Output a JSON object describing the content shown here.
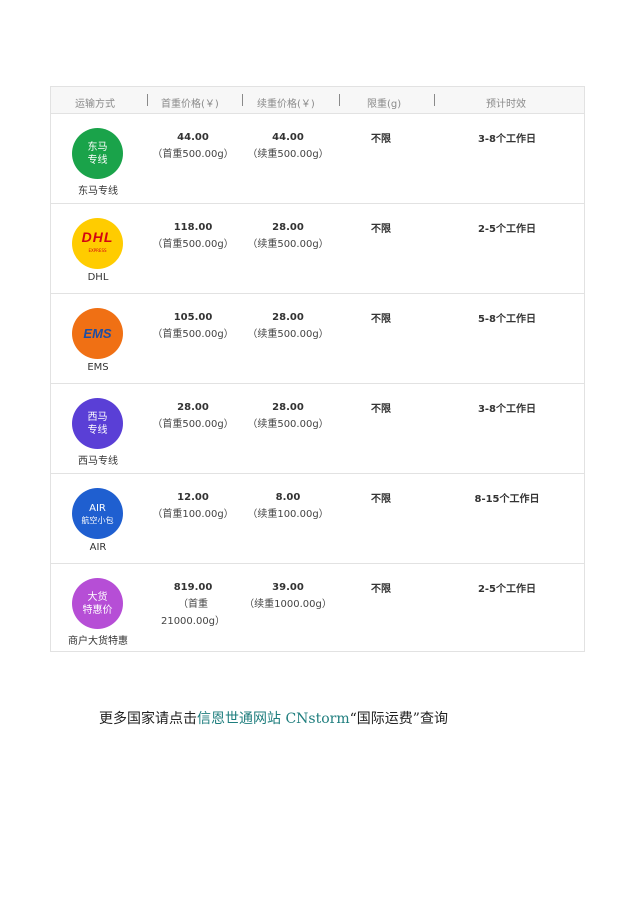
{
  "table": {
    "headers": {
      "method": "运输方式",
      "first_weight_price": "首重价格(￥)",
      "continued_weight_price": "续重价格(￥)",
      "limit": "限重(g)",
      "eta": "预计时效"
    },
    "rows": [
      {
        "logo_lines": [
          "东马",
          "专线"
        ],
        "name": "东马专线",
        "first_price": "44.00",
        "first_note": "（首重500.00g）",
        "cont_price": "44.00",
        "cont_note": "（续重500.00g）",
        "limit": "不限",
        "eta": "3-8个工作日",
        "color": "#1aa34a"
      },
      {
        "logo_lines": [
          "DHL",
          "EXPRESS"
        ],
        "name": "DHL",
        "first_price": "118.00",
        "first_note": "（首重500.00g）",
        "cont_price": "28.00",
        "cont_note": "（续重500.00g）",
        "limit": "不限",
        "eta": "2-5个工作日",
        "color": "#ffcc00"
      },
      {
        "logo_lines": [
          "EMS"
        ],
        "name": "EMS",
        "first_price": "105.00",
        "first_note": "（首重500.00g）",
        "cont_price": "28.00",
        "cont_note": "（续重500.00g）",
        "limit": "不限",
        "eta": "5-8个工作日",
        "color": "#f07014"
      },
      {
        "logo_lines": [
          "西马",
          "专线"
        ],
        "name": "西马专线",
        "first_price": "28.00",
        "first_note": "（首重500.00g）",
        "cont_price": "28.00",
        "cont_note": "（续重500.00g）",
        "limit": "不限",
        "eta": "3-8个工作日",
        "color": "#5a3fd6"
      },
      {
        "logo_lines": [
          "AIR",
          "航空小包"
        ],
        "name": "AIR",
        "first_price": "12.00",
        "first_note": "（首重100.00g）",
        "cont_price": "8.00",
        "cont_note": "（续重100.00g）",
        "limit": "不限",
        "eta": "8-15个工作日",
        "color": "#1f5fd0"
      },
      {
        "logo_lines": [
          "大货",
          "特惠价"
        ],
        "name": "商户大货特惠",
        "first_price": "819.00",
        "first_note_lines": [
          "（首重",
          "21000.00g）"
        ],
        "cont_price": "39.00",
        "cont_note": "（续重1000.00g）",
        "limit": "不限",
        "eta": "2-5个工作日",
        "color": "#b64ed6"
      }
    ]
  },
  "footer": {
    "prefix": "更多国家请点击",
    "link_text": "信恩世通网站 CNstorm",
    "suffix": "“国际运费”查询"
  }
}
